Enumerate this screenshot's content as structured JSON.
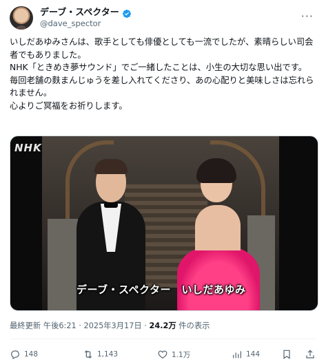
{
  "author": {
    "display_name": "デーブ・スペクター",
    "handle": "@dave_spector"
  },
  "tweet": {
    "text": "いしだあゆみさんは、歌手としても俳優としても一流でしたが、素晴らしい司会者でもありました。\nNHK「ときめき夢サウンド」でご一緒したことは、小生の大切な思い出です。\n毎回老舗の麩まんじゅうを差し入れてくださり、あの心配りと美味しさは忘れられません。\n心よりご冥福をお祈りします。"
  },
  "media": {
    "logo_text": "NHK",
    "caption": "デーブ・スペクター　いしだあゆみ"
  },
  "meta": {
    "prefix": "最終更新 午後6:21 · 2025年3月17日 · ",
    "views_count": "24.2万",
    "views_suffix": " 件の表示"
  },
  "actions": {
    "reply_count": "148",
    "retweet_count": "1,143",
    "like_count": "1.1万",
    "views_count": "144"
  },
  "colors": {
    "verified": "#1d9bf0",
    "muted": "#536471",
    "text": "#0f1419"
  },
  "icons": {
    "verified": "verified-badge-icon",
    "reply": "reply-icon",
    "retweet": "retweet-icon",
    "like": "heart-icon",
    "views": "views-icon",
    "bookmark": "bookmark-icon",
    "share": "share-icon",
    "more": "more-icon"
  }
}
